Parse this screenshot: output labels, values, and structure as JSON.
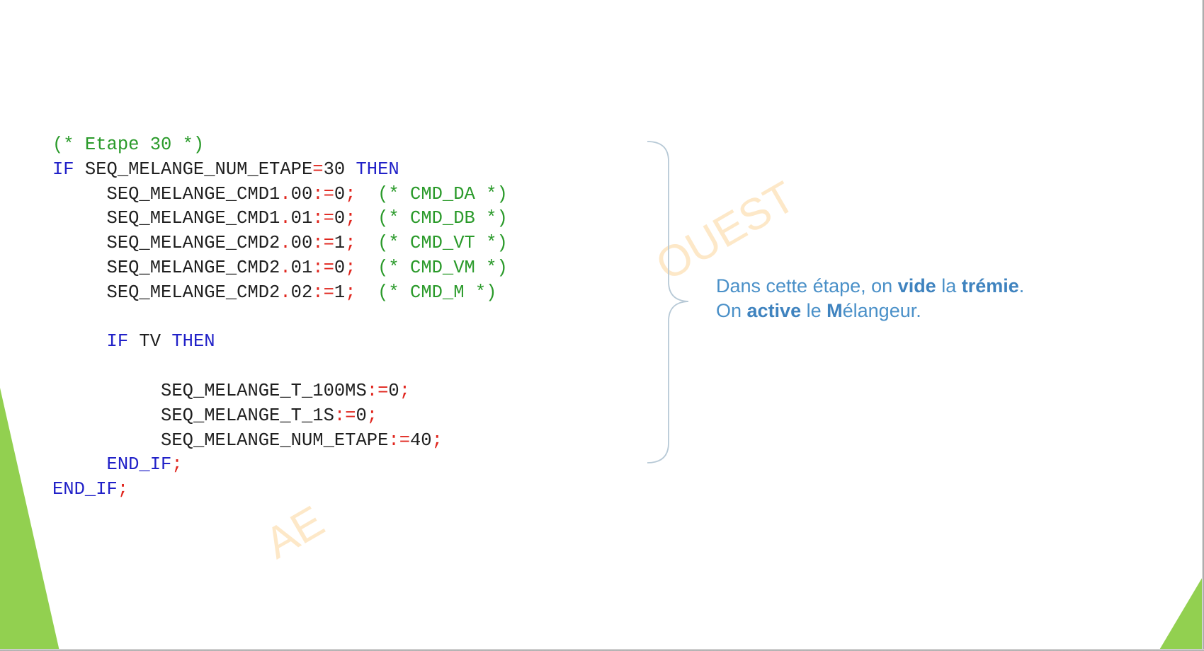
{
  "colors": {
    "keyword": "#2121c8",
    "comment": "#2a9a2a",
    "operator": "#e0261e",
    "identifier": "#1f1f1f",
    "annotation": "#4a90c8",
    "accent_green": "#92d050",
    "watermark": "#fde8c8"
  },
  "watermark": {
    "text_right": "OUEST",
    "text_left": "AE"
  },
  "code_lines": [
    {
      "indent": 0,
      "tokens": [
        {
          "t": "cm",
          "v": "(* Etape 30 *)"
        }
      ]
    },
    {
      "indent": 0,
      "tokens": [
        {
          "t": "kw",
          "v": "IF"
        },
        {
          "t": "id",
          "v": " SEQ_MELANGE_NUM_ETAPE"
        },
        {
          "t": "op",
          "v": "="
        },
        {
          "t": "id",
          "v": "30 "
        },
        {
          "t": "kw",
          "v": "THEN"
        }
      ]
    },
    {
      "indent": 1,
      "tokens": [
        {
          "t": "id",
          "v": "SEQ_MELANGE_CMD1"
        },
        {
          "t": "op",
          "v": "."
        },
        {
          "t": "id",
          "v": "00"
        },
        {
          "t": "op",
          "v": ":="
        },
        {
          "t": "id",
          "v": "0"
        },
        {
          "t": "op",
          "v": ";"
        },
        {
          "t": "cm",
          "v": "  (* CMD_DA *)"
        }
      ]
    },
    {
      "indent": 1,
      "tokens": [
        {
          "t": "id",
          "v": "SEQ_MELANGE_CMD1"
        },
        {
          "t": "op",
          "v": "."
        },
        {
          "t": "id",
          "v": "01"
        },
        {
          "t": "op",
          "v": ":="
        },
        {
          "t": "id",
          "v": "0"
        },
        {
          "t": "op",
          "v": ";"
        },
        {
          "t": "cm",
          "v": "  (* CMD_DB *)"
        }
      ]
    },
    {
      "indent": 1,
      "tokens": [
        {
          "t": "id",
          "v": "SEQ_MELANGE_CMD2"
        },
        {
          "t": "op",
          "v": "."
        },
        {
          "t": "id",
          "v": "00"
        },
        {
          "t": "op",
          "v": ":="
        },
        {
          "t": "id",
          "v": "1"
        },
        {
          "t": "op",
          "v": ";"
        },
        {
          "t": "cm",
          "v": "  (* CMD_VT *)"
        }
      ]
    },
    {
      "indent": 1,
      "tokens": [
        {
          "t": "id",
          "v": "SEQ_MELANGE_CMD2"
        },
        {
          "t": "op",
          "v": "."
        },
        {
          "t": "id",
          "v": "01"
        },
        {
          "t": "op",
          "v": ":="
        },
        {
          "t": "id",
          "v": "0"
        },
        {
          "t": "op",
          "v": ";"
        },
        {
          "t": "cm",
          "v": "  (* CMD_VM *)"
        }
      ]
    },
    {
      "indent": 1,
      "tokens": [
        {
          "t": "id",
          "v": "SEQ_MELANGE_CMD2"
        },
        {
          "t": "op",
          "v": "."
        },
        {
          "t": "id",
          "v": "02"
        },
        {
          "t": "op",
          "v": ":="
        },
        {
          "t": "id",
          "v": "1"
        },
        {
          "t": "op",
          "v": ";"
        },
        {
          "t": "cm",
          "v": "  (* CMD_M *)"
        }
      ]
    },
    {
      "indent": 0,
      "tokens": []
    },
    {
      "indent": 1,
      "tokens": [
        {
          "t": "kw",
          "v": "IF"
        },
        {
          "t": "id",
          "v": " TV "
        },
        {
          "t": "kw",
          "v": "THEN"
        }
      ]
    },
    {
      "indent": 0,
      "tokens": []
    },
    {
      "indent": 2,
      "tokens": [
        {
          "t": "id",
          "v": "SEQ_MELANGE_T_100MS"
        },
        {
          "t": "op",
          "v": ":="
        },
        {
          "t": "id",
          "v": "0"
        },
        {
          "t": "op",
          "v": ";"
        }
      ]
    },
    {
      "indent": 2,
      "tokens": [
        {
          "t": "id",
          "v": "SEQ_MELANGE_T_1S"
        },
        {
          "t": "op",
          "v": ":="
        },
        {
          "t": "id",
          "v": "0"
        },
        {
          "t": "op",
          "v": ";"
        }
      ]
    },
    {
      "indent": 2,
      "tokens": [
        {
          "t": "id",
          "v": "SEQ_MELANGE_NUM_ETAPE"
        },
        {
          "t": "op",
          "v": ":="
        },
        {
          "t": "id",
          "v": "40"
        },
        {
          "t": "op",
          "v": ";"
        }
      ]
    },
    {
      "indent": 1,
      "tokens": [
        {
          "t": "kw",
          "v": "END_IF"
        },
        {
          "t": "op",
          "v": ";"
        }
      ]
    },
    {
      "indent": 0,
      "tokens": [
        {
          "t": "kw",
          "v": "END_IF"
        },
        {
          "t": "op",
          "v": ";"
        }
      ]
    }
  ],
  "annotation": {
    "line1": {
      "pre": "Dans cette étape, on ",
      "b1": "vide",
      "mid": " la ",
      "b2": "trémie",
      "post": "."
    },
    "line2": {
      "pre": "On ",
      "b1": "active",
      "mid": " le ",
      "b2": "M",
      "post": "élangeur."
    }
  }
}
